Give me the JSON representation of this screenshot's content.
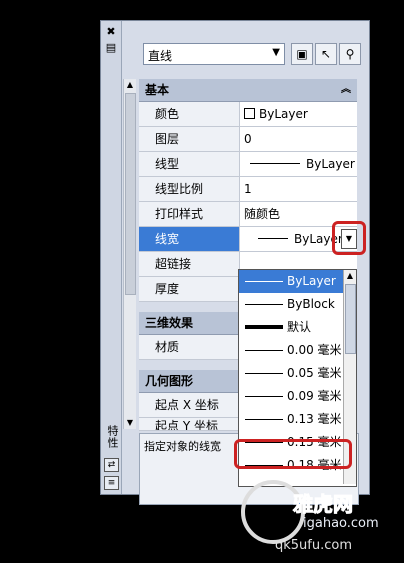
{
  "toolbar": {
    "object_type": "直线"
  },
  "vertical_title": "特性",
  "category_basic": "基本",
  "rows": [
    {
      "label": "颜色",
      "value": "ByLayer",
      "swatch": true
    },
    {
      "label": "图层",
      "value": "0"
    },
    {
      "label": "线型",
      "value": "ByLayer",
      "linestyle": true
    },
    {
      "label": "线型比例",
      "value": "1"
    },
    {
      "label": "打印样式",
      "value": "随颜色"
    },
    {
      "label": "线宽",
      "value": "ByLayer",
      "selected": true
    },
    {
      "label": "超链接",
      "value": ""
    },
    {
      "label": "厚度",
      "value": ""
    }
  ],
  "category_3d": "三维效果",
  "row_material": "材质",
  "category_geometry": "几何图形",
  "row_start_x": "起点 X 坐标",
  "row_start_y": "起点 Y 坐标",
  "lineweight_options": [
    "ByLayer",
    "ByBlock",
    "默认",
    "0.00 毫米",
    "0.05 毫米",
    "0.09 毫米",
    "0.13 毫米",
    "0.15 毫米",
    "0.18 毫米"
  ],
  "description": "指定对象的线宽",
  "watermark": {
    "line1": "雅虎网",
    "line2": "igahao.com",
    "line3": "qk5ufu.com"
  },
  "colors": {
    "selection": "#3a7bd5",
    "highlight": "#cc2222"
  }
}
